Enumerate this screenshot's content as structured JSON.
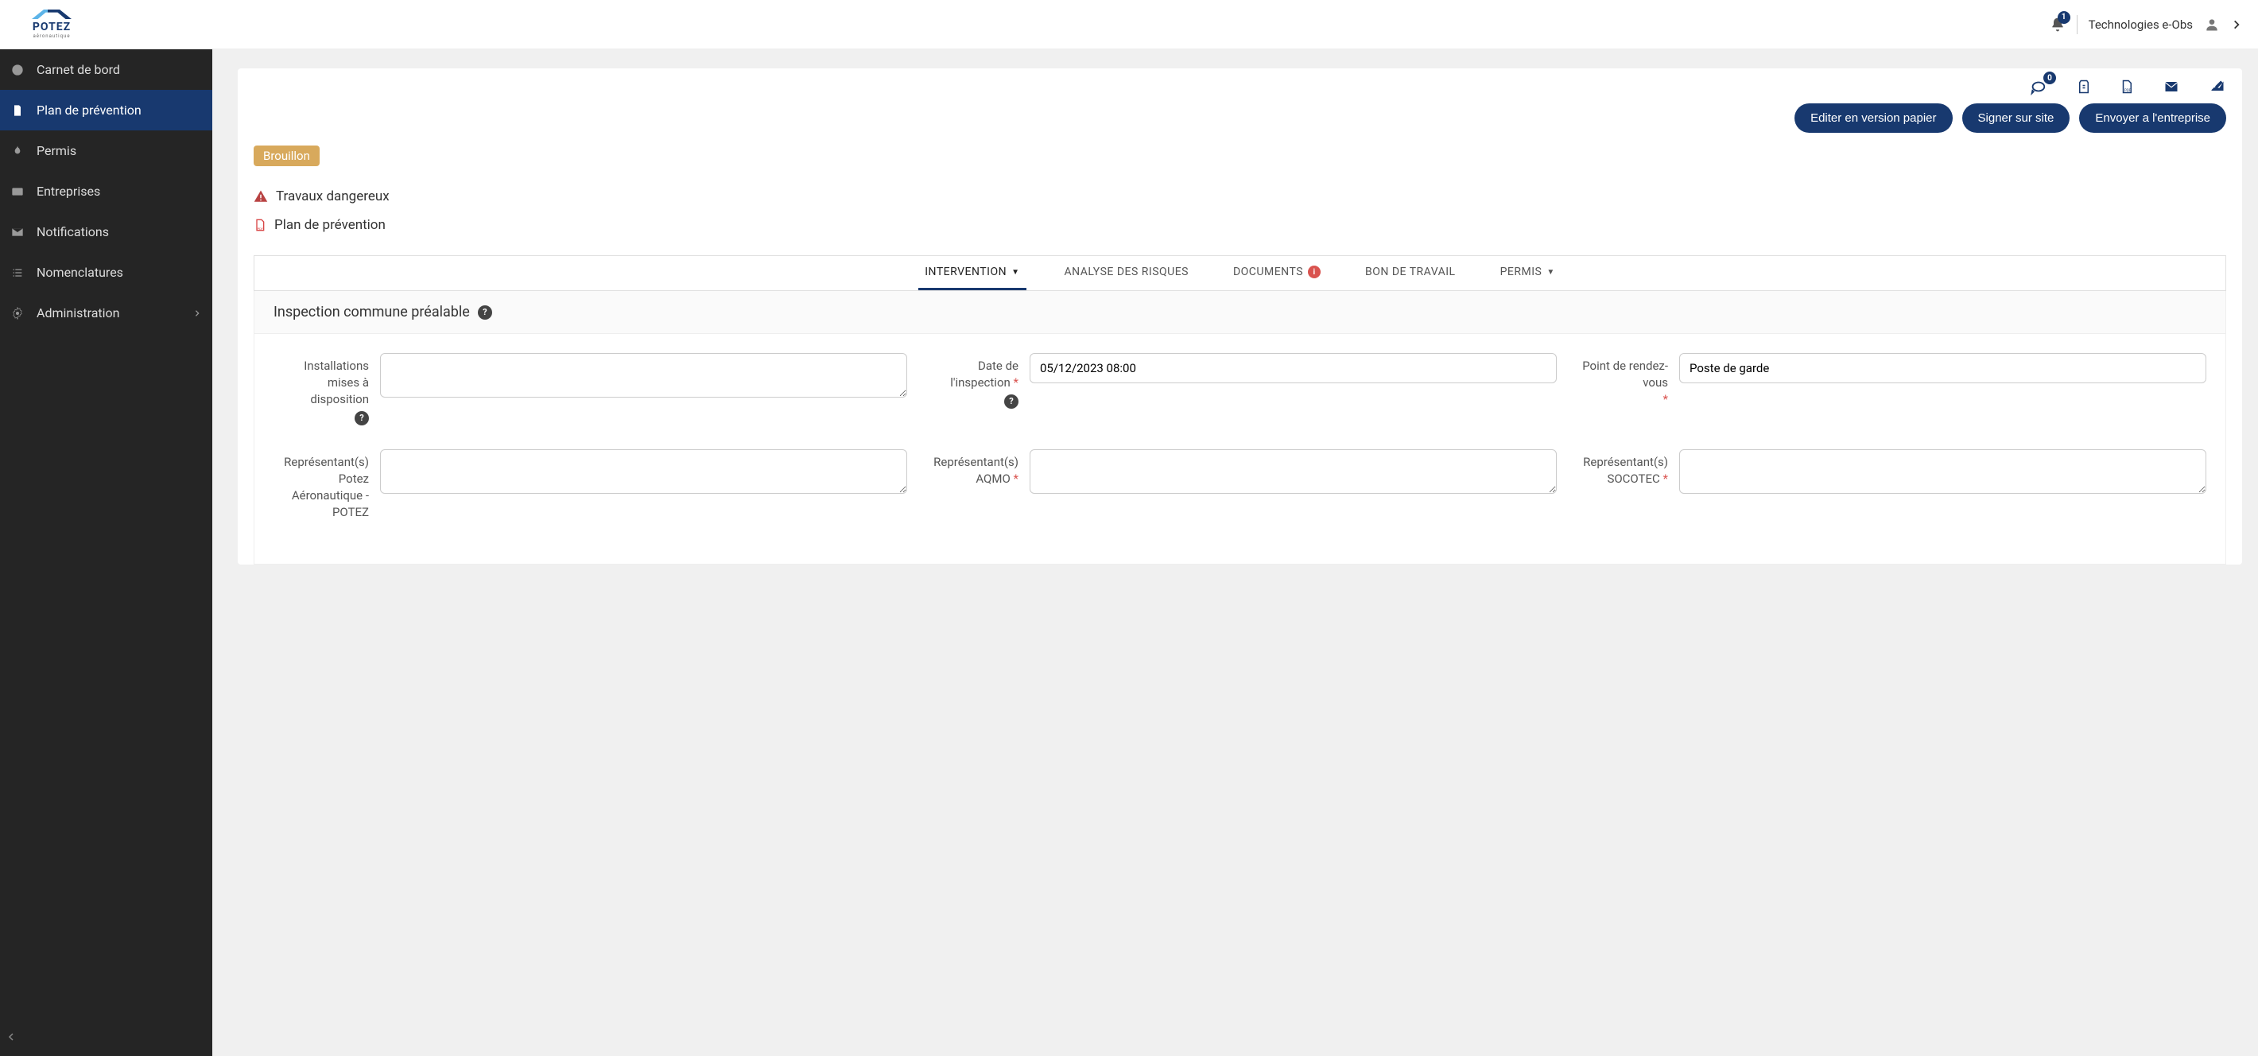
{
  "header": {
    "logo_text": "POTEZ",
    "logo_sub": "aéronautique",
    "notif_count": "1",
    "user_name": "Technologies e-Obs"
  },
  "sidebar": {
    "items": [
      {
        "label": "Carnet de bord"
      },
      {
        "label": "Plan de prévention"
      },
      {
        "label": "Permis"
      },
      {
        "label": "Entreprises"
      },
      {
        "label": "Notifications"
      },
      {
        "label": "Nomenclatures"
      },
      {
        "label": "Administration"
      }
    ]
  },
  "toolbar": {
    "comment_count": "0",
    "buttons": {
      "edit_paper": "Editer en version papier",
      "sign_onsite": "Signer sur site",
      "send_company": "Envoyer a l'entreprise"
    }
  },
  "status": "Brouillon",
  "flags": {
    "dangerous": "Travaux dangereux",
    "plan": "Plan de prévention"
  },
  "tabs": {
    "intervention": "INTERVENTION",
    "risks": "ANALYSE DES RISQUES",
    "documents": "DOCUMENTS",
    "workorder": "BON DE TRAVAIL",
    "permits": "PERMIS"
  },
  "section": {
    "title": "Inspection commune préalable",
    "fields": {
      "installations_label": "Installations mises à disposition",
      "installations_value": "",
      "date_label": "Date de l'inspection",
      "date_value": "05/12/2023 08:00",
      "point_label": "Point de rendez-vous",
      "point_value": "Poste de garde",
      "rep_potez_label": "Représentant(s) Potez Aéronautique - POTEZ",
      "rep_potez_value": "",
      "rep_aqmo_label": "Représentant(s) AQMO",
      "rep_aqmo_value": "",
      "rep_socotec_label": "Représentant(s) SOCOTEC",
      "rep_socotec_value": ""
    }
  }
}
